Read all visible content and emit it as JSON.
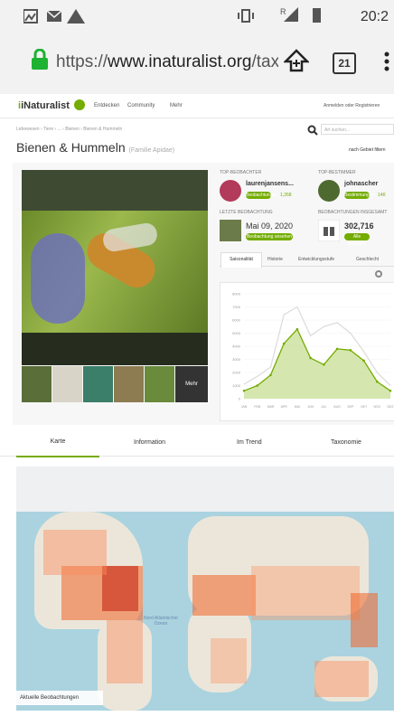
{
  "status": {
    "time": "20:2"
  },
  "browser": {
    "url_scheme": "https://",
    "url_domain": "www.inaturalist.org",
    "url_path": "/taxa",
    "tab_count": "21"
  },
  "inat": {
    "logo": "iNaturalist",
    "nav": [
      "Entdecken",
      "Community",
      "Mehr"
    ],
    "login": "Anmelden oder Registrieren",
    "breadcrumb": "Lebewesen › Tiere › ... › Bienen › Bienen & Hummeln",
    "search_placeholder": "Art suchen...",
    "title": "Bienen & Hummeln",
    "subtitle": "(Familie Apidae)",
    "location_filter": "nach Gebiet filtern",
    "more_photos": "Mehr",
    "top_observer_label": "TOP-BEOBACHTER",
    "top_observer_name": "laurenjansens...",
    "top_observer_btn": "Beobachtungen",
    "top_observer_count": "1,358",
    "top_identifier_label": "TOP-BESTIMMER",
    "top_identifier_name": "johnascher",
    "top_identifier_btn": "Bestimmungen",
    "top_identifier_count": "14K",
    "last_obs_label": "LETZTE BEOBACHTUNG",
    "last_obs_date": "Mai 09, 2020",
    "last_obs_btn": "Beobachtung ansehen",
    "total_obs_label": "BEOBACHTUNGEN INSGESAMT",
    "total_obs_count": "302,716",
    "total_obs_btn": "Alle ansehen",
    "chart_tabs": [
      "Saisonalität",
      "Historie",
      "Entwicklungsstufe",
      "Geschlecht"
    ],
    "main_tabs": [
      "Karte",
      "Information",
      "Im Trend",
      "Taxonomie"
    ],
    "map_labels": {
      "ocean1": "Nord Atlantischer Ozean",
      "caption": "Aktuelle Beobachtungen"
    }
  },
  "chart_data": {
    "type": "line",
    "x": [
      "JAN",
      "FEB",
      "MÄR",
      "APR",
      "MAI",
      "JUN",
      "JUL",
      "AUG",
      "SEP",
      "OKT",
      "NOV",
      "DEZ"
    ],
    "y_ticks": [
      "8000",
      "7000",
      "6000",
      "5000",
      "4000",
      "3000",
      "2000",
      "1000",
      "0"
    ],
    "ylim": [
      0,
      8000
    ],
    "series": [
      {
        "name": "",
        "color": "#dddddd",
        "values": [
          1100,
          1700,
          2400,
          6400,
          7000,
          4800,
          5500,
          5800,
          5000,
          3600,
          2000,
          1000
        ]
      },
      {
        "name": "",
        "color": "#74ac00",
        "values": [
          600,
          1000,
          1800,
          4200,
          5300,
          3100,
          2600,
          3800,
          3700,
          2900,
          1300,
          600
        ]
      }
    ]
  }
}
